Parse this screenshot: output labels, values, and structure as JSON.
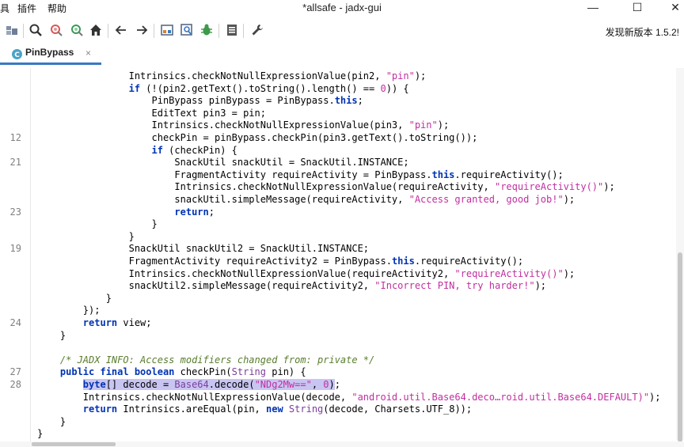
{
  "window": {
    "title": "*allsafe - jadx-gui",
    "minimize_glyph": "—",
    "maximize_glyph": "☐",
    "close_glyph": "✕"
  },
  "menu": {
    "items": [
      {
        "label": "具"
      },
      {
        "label": "插件"
      },
      {
        "label": "帮助"
      }
    ]
  },
  "toolbar": {
    "buttons": [
      {
        "name": "sync-tree-icon"
      },
      {
        "name": "search-icon"
      },
      {
        "name": "find-usage-icon"
      },
      {
        "name": "find-class-icon"
      },
      {
        "name": "home-icon"
      },
      {
        "name": "back-arrow-icon"
      },
      {
        "name": "forward-arrow-icon"
      },
      {
        "name": "deobfuscation-icon"
      },
      {
        "name": "quick-search-icon"
      },
      {
        "name": "debug-bug-icon"
      },
      {
        "name": "log-viewer-icon"
      },
      {
        "name": "preferences-wrench-icon"
      }
    ],
    "update_notice": "发现新版本 1.5.2!"
  },
  "tabs": [
    {
      "label": "PinBypass",
      "close": "×",
      "active": true
    }
  ],
  "colors": {
    "keyword": "#0033b3",
    "string": "#c12fa0",
    "comment": "#5a7d2e",
    "type": "#7a3e9d",
    "selection": "#c9c5f2",
    "tab_accent": "#3a78c3"
  },
  "code_lines": [
    {
      "ln": "",
      "tokens": [
        [
          "p",
          "                Intrinsics.checkNotNullExpressionValue(pin2, "
        ],
        [
          "str",
          "\"pin\""
        ],
        [
          "p",
          ");"
        ]
      ]
    },
    {
      "ln": "",
      "tokens": [
        [
          "p",
          "                "
        ],
        [
          "kw",
          "if"
        ],
        [
          "p",
          " (!(pin2.getText().toString().length() == "
        ],
        [
          "str",
          "0"
        ],
        [
          "p",
          ")) {"
        ]
      ]
    },
    {
      "ln": "",
      "tokens": [
        [
          "p",
          "                    PinBypass pinBypass = PinBypass."
        ],
        [
          "kw",
          "this"
        ],
        [
          "p",
          ";"
        ]
      ]
    },
    {
      "ln": "",
      "tokens": [
        [
          "p",
          "                    EditText pin3 = pin;"
        ]
      ]
    },
    {
      "ln": "",
      "tokens": [
        [
          "p",
          "                    Intrinsics.checkNotNullExpressionValue(pin3, "
        ],
        [
          "str",
          "\"pin\""
        ],
        [
          "p",
          ");"
        ]
      ]
    },
    {
      "ln": "12",
      "tokens": [
        [
          "p",
          "                    checkPin = pinBypass.checkPin(pin3.getText().toString());"
        ]
      ]
    },
    {
      "ln": "",
      "tokens": [
        [
          "p",
          "                    "
        ],
        [
          "kw",
          "if"
        ],
        [
          "p",
          " (checkPin) {"
        ]
      ]
    },
    {
      "ln": "21",
      "tokens": [
        [
          "p",
          "                        SnackUtil snackUtil = SnackUtil.INSTANCE;"
        ]
      ]
    },
    {
      "ln": "",
      "tokens": [
        [
          "p",
          "                        FragmentActivity requireActivity = PinBypass."
        ],
        [
          "kw",
          "this"
        ],
        [
          "p",
          ".requireActivity();"
        ]
      ]
    },
    {
      "ln": "",
      "tokens": [
        [
          "p",
          "                        Intrinsics.checkNotNullExpressionValue(requireActivity, "
        ],
        [
          "str",
          "\"requireActivity()\""
        ],
        [
          "p",
          ");"
        ]
      ]
    },
    {
      "ln": "",
      "tokens": [
        [
          "p",
          "                        snackUtil.simpleMessage(requireActivity, "
        ],
        [
          "str",
          "\"Access granted, good job!\""
        ],
        [
          "p",
          ");"
        ]
      ]
    },
    {
      "ln": "23",
      "tokens": [
        [
          "p",
          "                        "
        ],
        [
          "kw",
          "return"
        ],
        [
          "p",
          ";"
        ]
      ]
    },
    {
      "ln": "",
      "tokens": [
        [
          "p",
          "                    }"
        ]
      ]
    },
    {
      "ln": "",
      "tokens": [
        [
          "p",
          "                }"
        ]
      ]
    },
    {
      "ln": "19",
      "tokens": [
        [
          "p",
          "                SnackUtil snackUtil2 = SnackUtil.INSTANCE;"
        ]
      ]
    },
    {
      "ln": "",
      "tokens": [
        [
          "p",
          "                FragmentActivity requireActivity2 = PinBypass."
        ],
        [
          "kw",
          "this"
        ],
        [
          "p",
          ".requireActivity();"
        ]
      ]
    },
    {
      "ln": "",
      "tokens": [
        [
          "p",
          "                Intrinsics.checkNotNullExpressionValue(requireActivity2, "
        ],
        [
          "str",
          "\"requireActivity()\""
        ],
        [
          "p",
          ");"
        ]
      ]
    },
    {
      "ln": "",
      "tokens": [
        [
          "p",
          "                snackUtil2.simpleMessage(requireActivity2, "
        ],
        [
          "str",
          "\"Incorrect PIN, try harder!\""
        ],
        [
          "p",
          ");"
        ]
      ]
    },
    {
      "ln": "",
      "tokens": [
        [
          "p",
          "            }"
        ]
      ]
    },
    {
      "ln": "",
      "tokens": [
        [
          "p",
          "        });"
        ]
      ]
    },
    {
      "ln": "24",
      "tokens": [
        [
          "p",
          "        "
        ],
        [
          "kw",
          "return"
        ],
        [
          "p",
          " view;"
        ]
      ]
    },
    {
      "ln": "",
      "tokens": [
        [
          "p",
          "    }"
        ]
      ]
    },
    {
      "ln": "",
      "tokens": [
        [
          "p",
          ""
        ]
      ]
    },
    {
      "ln": "",
      "tokens": [
        [
          "com",
          "    /* JADX INFO: Access modifiers changed from: private */"
        ]
      ]
    },
    {
      "ln": "27",
      "tokens": [
        [
          "p",
          "    "
        ],
        [
          "kw",
          "public final boolean"
        ],
        [
          "p",
          " checkPin("
        ],
        [
          "type",
          "String"
        ],
        [
          "p",
          " pin) {"
        ]
      ]
    },
    {
      "ln": "28",
      "tokens": [
        [
          "p",
          "        "
        ],
        [
          "hlkw",
          "byte"
        ],
        [
          "hl",
          "[] decode = "
        ],
        [
          "hltype",
          "Base64"
        ],
        [
          "hl",
          ".decode("
        ],
        [
          "hlstr",
          "\"NDg2Mw==\""
        ],
        [
          "hl",
          ", "
        ],
        [
          "hlstr",
          "0"
        ],
        [
          "hl",
          ")"
        ],
        [
          "p",
          ";"
        ]
      ]
    },
    {
      "ln": "",
      "tokens": [
        [
          "p",
          "        Intrinsics.checkNotNullExpressionValue(decode, "
        ],
        [
          "str",
          "\"android.util.Base64.deco…roid.util.Base64.DEFAULT)\""
        ],
        [
          "p",
          ");"
        ]
      ]
    },
    {
      "ln": "",
      "tokens": [
        [
          "p",
          "        "
        ],
        [
          "kw",
          "return"
        ],
        [
          "p",
          " Intrinsics.areEqual(pin, "
        ],
        [
          "kw",
          "new"
        ],
        [
          "p",
          " "
        ],
        [
          "type",
          "String"
        ],
        [
          "p",
          "(decode, Charsets.UTF_8));"
        ]
      ]
    },
    {
      "ln": "",
      "tokens": [
        [
          "p",
          "    }"
        ]
      ]
    },
    {
      "ln": "",
      "tokens": [
        [
          "p",
          "}"
        ]
      ]
    }
  ]
}
